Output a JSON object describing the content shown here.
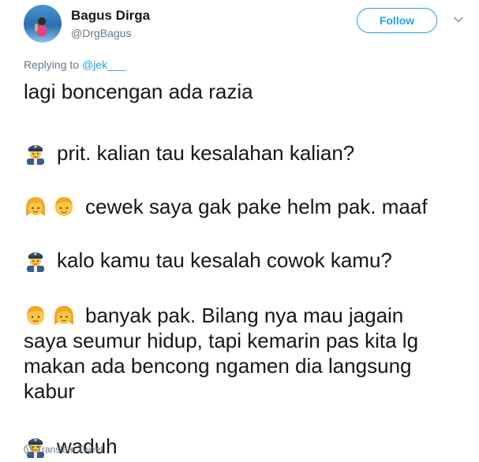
{
  "author": {
    "name": "Bagus Dirga",
    "handle": "@DrgBagus"
  },
  "follow_label": "Follow",
  "replying": {
    "prefix": "Replying to",
    "mention": "@jek___"
  },
  "tweet": {
    "line1": "lagi boncengan ada razia",
    "line2": "prit. kalian tau kesalahan kalian?",
    "line3": "cewek saya gak pake helm pak. maaf",
    "line4": "kalo kamu tau kesalah cowok kamu?",
    "line5a": "banyak pak. Bilang nya mau jagain",
    "line5b": "saya seumur hidup, tapi kemarin pas kita lg",
    "line5c": "makan ada bencong ngamen dia langsung",
    "line5d": "kabur",
    "line6": "waduh"
  },
  "emoji_icons": {
    "police": "police-officer-icon",
    "girl": "girl-face-icon",
    "boy": "boy-face-icon"
  },
  "translate_label": "Translate Tweet",
  "colors": {
    "accent": "#1da1f2",
    "secondary_text": "#657786",
    "text": "#14171a"
  }
}
